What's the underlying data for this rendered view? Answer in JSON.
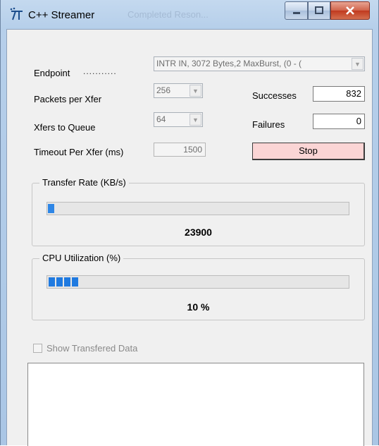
{
  "window": {
    "title": "C++ Streamer",
    "ghost_title": "Completed Reson..."
  },
  "endpoint": {
    "label": "Endpoint",
    "dots": "...........",
    "value": "INTR IN,     3072 Bytes,2 MaxBurst,  (0 - ("
  },
  "packets": {
    "label": "Packets per Xfer",
    "value": "256"
  },
  "queue": {
    "label": "Xfers to Queue",
    "value": "64"
  },
  "timeout": {
    "label": "Timeout Per Xfer (ms)",
    "value": "1500"
  },
  "successes": {
    "label": "Successes",
    "value": "832"
  },
  "failures": {
    "label": "Failures",
    "value": "0"
  },
  "stop_label": "Stop",
  "transfer": {
    "label": "Transfer Rate (KB/s)",
    "value": "23900",
    "fill_fraction": 0.02
  },
  "cpu": {
    "label": "CPU Utilization (%)",
    "value": "10 %",
    "segments": 4
  },
  "show_data_label": "Show Transfered Data",
  "colors": {
    "progress": "#2e86e6",
    "stop_bg": "#fbd5d5",
    "close_btn": "#c0391f"
  }
}
